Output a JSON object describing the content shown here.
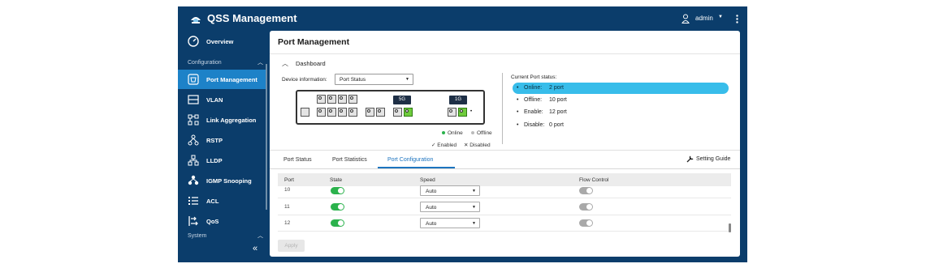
{
  "header": {
    "app_title": "QSS Management",
    "user": "admin",
    "brand_color": "#0b3d6b",
    "accent_color": "#1d82c8"
  },
  "sidebar": {
    "items": [
      {
        "label": "Overview",
        "icon": "speedometer-icon"
      },
      {
        "label": "Port Management",
        "icon": "port-icon",
        "active": true
      },
      {
        "label": "VLAN",
        "icon": "vlan-icon"
      },
      {
        "label": "Link Aggregation",
        "icon": "link-aggregation-icon"
      },
      {
        "label": "RSTP",
        "icon": "rstp-tree-icon"
      },
      {
        "label": "LLDP",
        "icon": "lldp-tree-icon"
      },
      {
        "label": "IGMP Snooping",
        "icon": "igmp-icon"
      },
      {
        "label": "ACL",
        "icon": "acl-list-icon"
      },
      {
        "label": "QoS",
        "icon": "qos-icon"
      }
    ],
    "sections": {
      "configuration": "Configuration",
      "system": "System"
    }
  },
  "main": {
    "page_title": "Port Management",
    "dashboard_label": "Dashboard",
    "device_info_label": "Device  information:",
    "device_select_value": "Port Status",
    "tags": {
      "five_g": "5G",
      "one_g": "1G"
    },
    "legend": {
      "online": "Online",
      "offline": "Offline",
      "enabled": "Enabled",
      "disabled": "Disabled"
    },
    "current_status_label": "Current  Port  status:",
    "status": [
      {
        "key": "Online:",
        "value": "2  port"
      },
      {
        "key": "Offline:",
        "value": "10  port"
      },
      {
        "key": "Enable:",
        "value": "12  port"
      },
      {
        "key": "Disable:",
        "value": "0  port"
      }
    ],
    "tabs": [
      "Port Status",
      "Port Statistics",
      "Port Configuration"
    ],
    "setting_guide": "Setting Guide",
    "table": {
      "headers": {
        "port": "Port",
        "state": "State",
        "speed": "Speed",
        "flow": "Flow  Control"
      },
      "rows": [
        {
          "port": "10",
          "speed": "Auto",
          "state_on": true,
          "flow_on": false
        },
        {
          "port": "11",
          "speed": "Auto",
          "state_on": true,
          "flow_on": false
        },
        {
          "port": "12",
          "speed": "Auto",
          "state_on": true,
          "flow_on": false
        }
      ]
    },
    "apply_label": "Apply"
  }
}
